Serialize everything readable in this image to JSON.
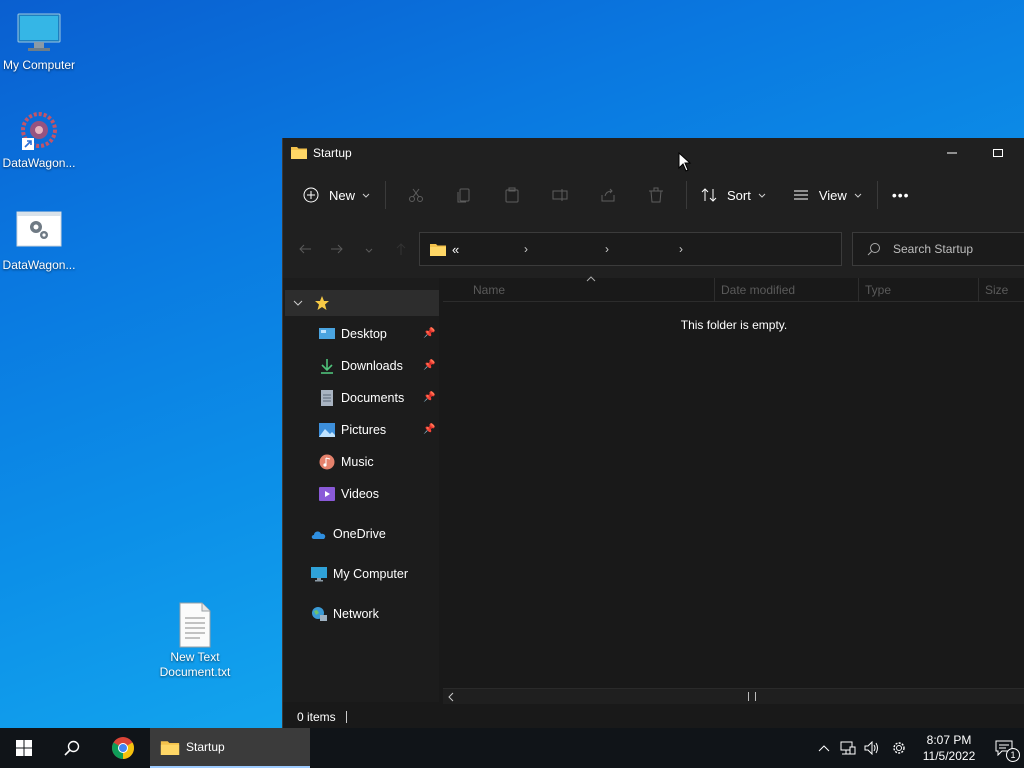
{
  "desktop": {
    "icons": [
      {
        "label": "My Computer",
        "icon": "monitor-icon"
      },
      {
        "label": "DataWagon...",
        "icon": "datawagon-shortcut-icon"
      },
      {
        "label": "DataWagon...",
        "icon": "settings-file-icon"
      },
      {
        "label": "New Text Document.txt",
        "icon": "text-file-icon"
      }
    ]
  },
  "window": {
    "title": "Startup",
    "toolbar": {
      "new_label": "New",
      "sort_label": "Sort",
      "view_label": "View",
      "more_label": "•••"
    },
    "address": {
      "prefix": "«",
      "chevrons": [
        "›",
        "›",
        "›"
      ]
    },
    "search_placeholder": "Search Startup",
    "nav": {
      "quick_access": [
        {
          "label": "Desktop",
          "icon": "desktop-folder-icon"
        },
        {
          "label": "Downloads",
          "icon": "download-icon"
        },
        {
          "label": "Documents",
          "icon": "documents-icon"
        },
        {
          "label": "Pictures",
          "icon": "pictures-icon"
        },
        {
          "label": "Music",
          "icon": "music-icon"
        },
        {
          "label": "Videos",
          "icon": "videos-icon"
        }
      ],
      "roots": [
        {
          "label": "OneDrive",
          "icon": "cloud-icon"
        },
        {
          "label": "My Computer",
          "icon": "monitor-icon"
        },
        {
          "label": "Network",
          "icon": "network-icon"
        }
      ]
    },
    "columns": [
      "Name",
      "Date modified",
      "Type",
      "Size"
    ],
    "empty_message": "This folder is empty.",
    "status": "0 items"
  },
  "taskbar": {
    "active_task": "Startup",
    "time": "8:07 PM",
    "date": "11/5/2022",
    "notification_count": "1"
  },
  "colors": {
    "accent": "#9ecbff",
    "folder": "#f4c24c"
  }
}
